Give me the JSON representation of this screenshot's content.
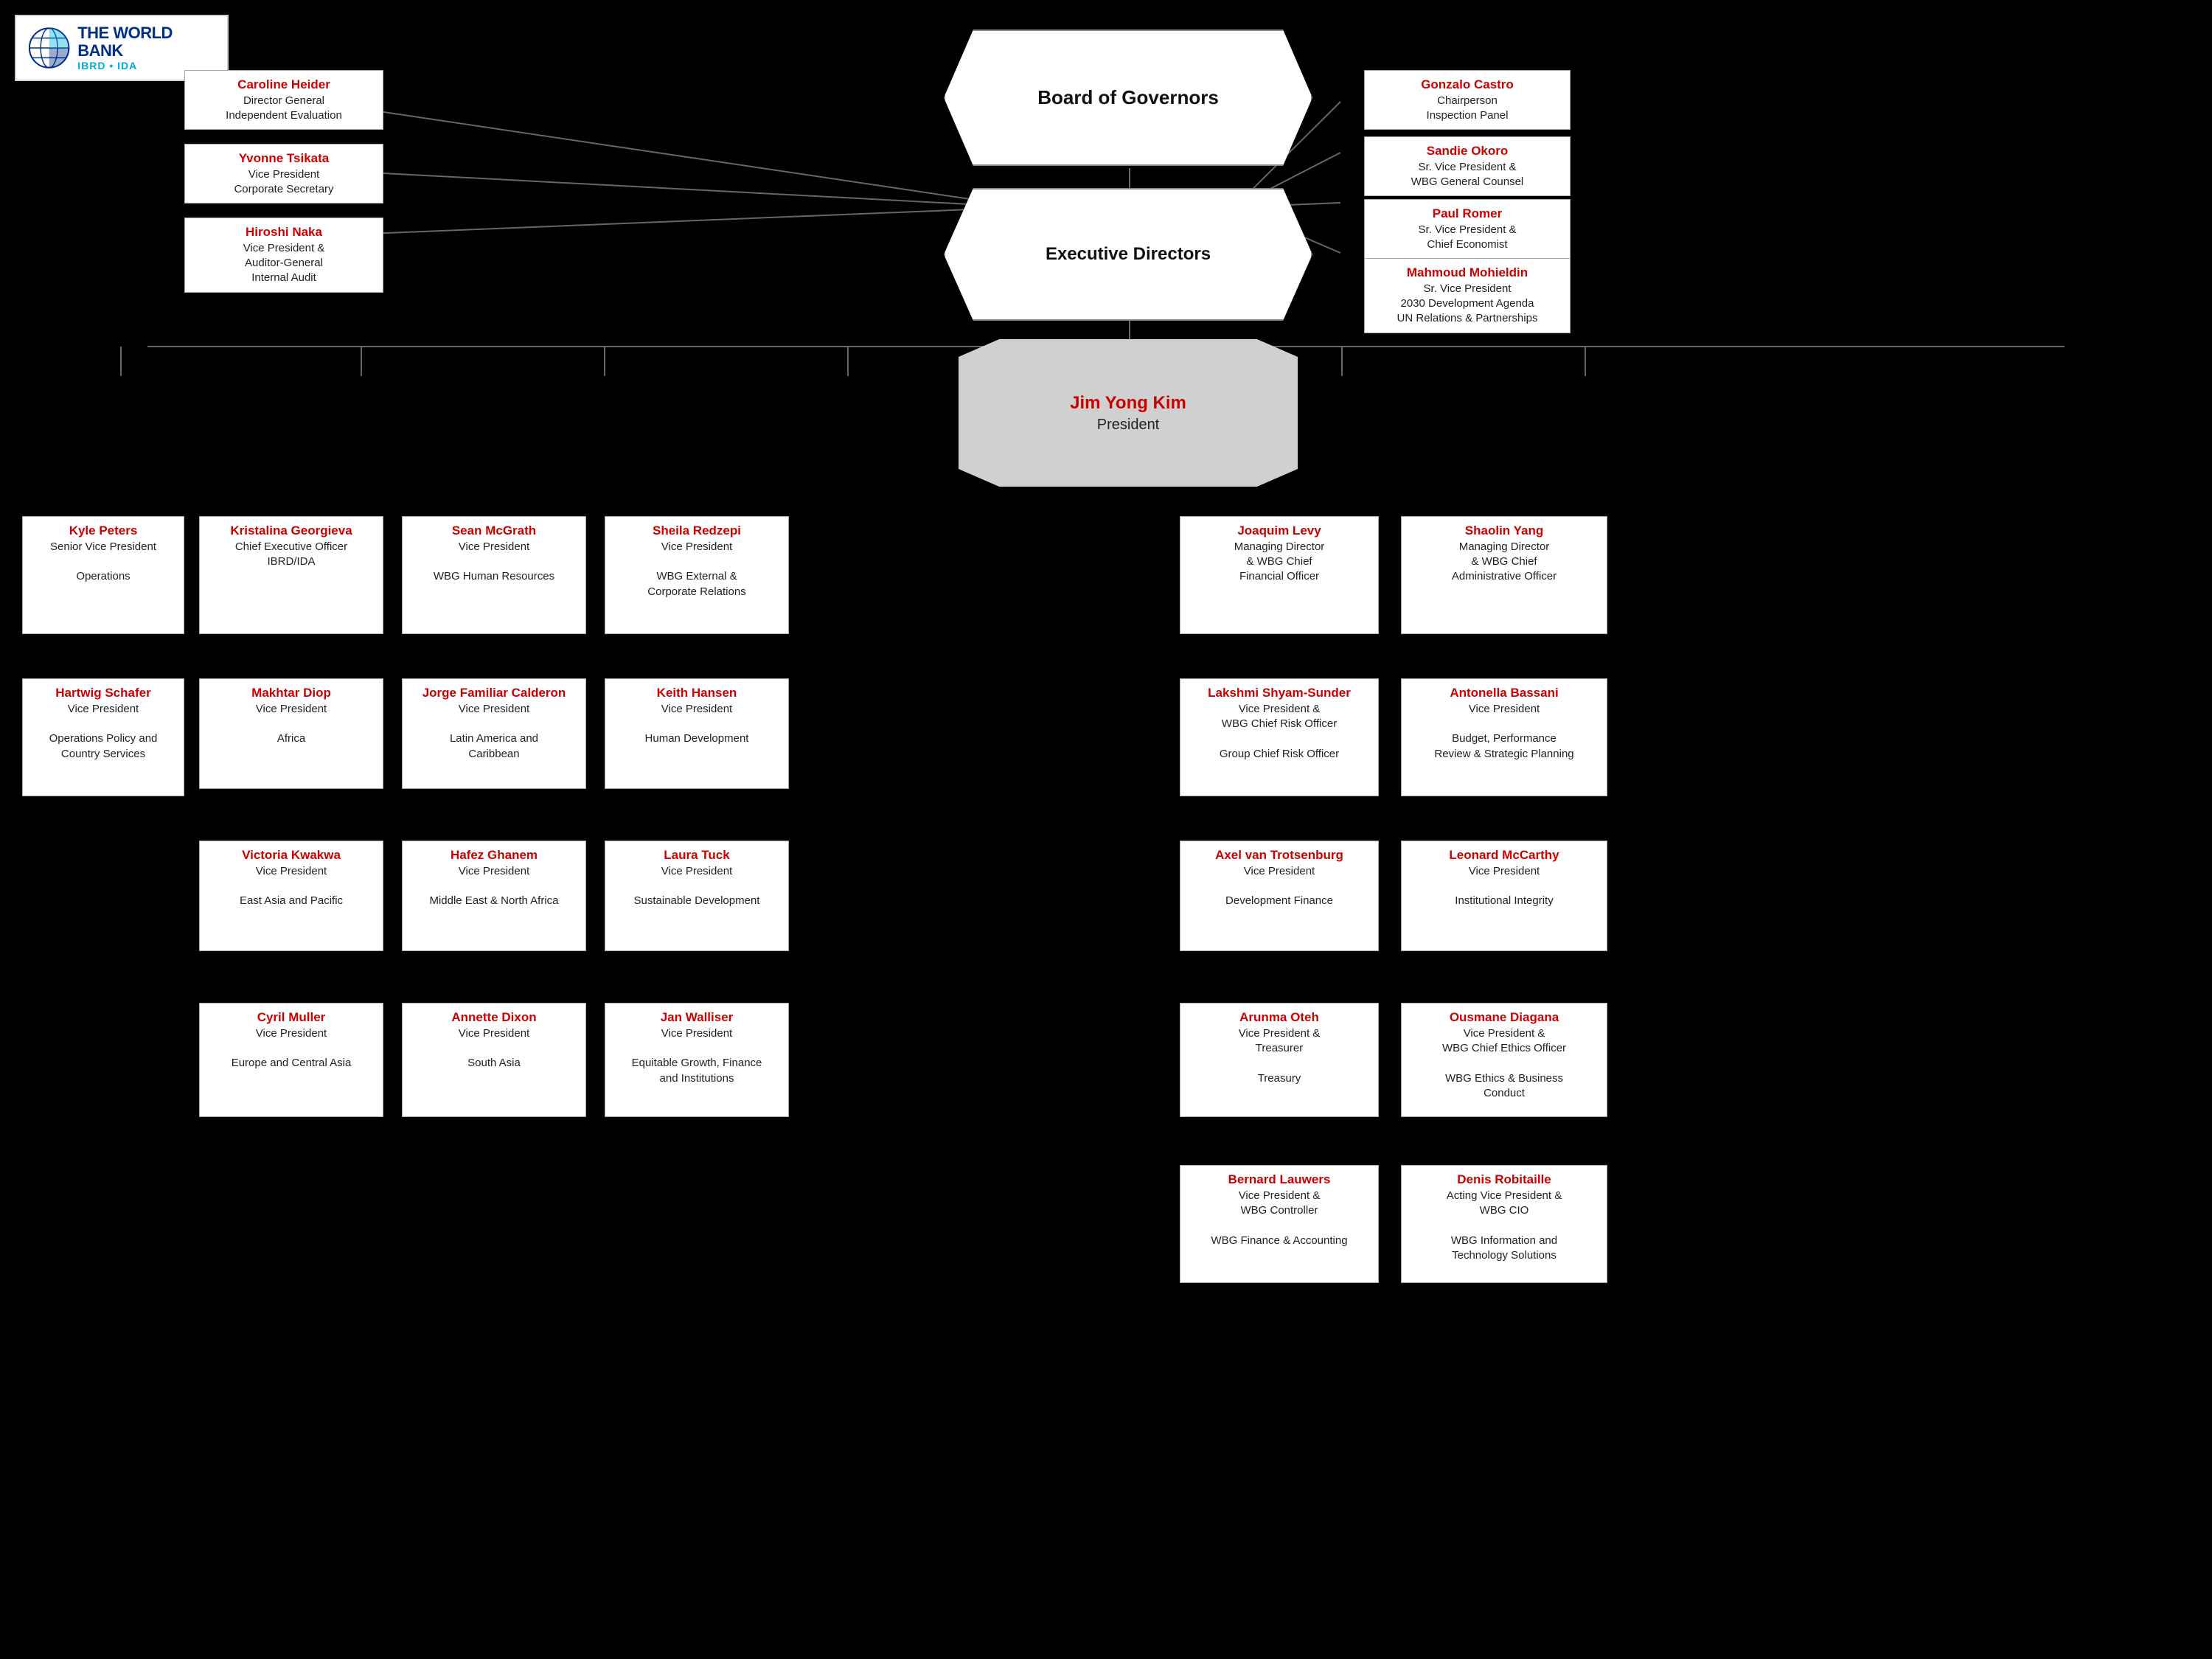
{
  "logo": {
    "main": "THE WORLD BANK",
    "sub": "IBRD • IDA"
  },
  "top_nodes": {
    "board_of_governors": {
      "label": "Board of Governors"
    },
    "executive_directors": {
      "label": "Executive Directors"
    },
    "president": {
      "name": "Jim Yong Kim",
      "title": "President"
    }
  },
  "left_direct_reports": [
    {
      "name": "Caroline Heider",
      "title": "Director General\nIndependent Evaluation"
    },
    {
      "name": "Yvonne Tsikata",
      "title": "Vice President\nCorporate Secretary"
    },
    {
      "name": "Hiroshi Naka",
      "title": "Vice President &\nAuditor-General\nInternal Audit"
    }
  ],
  "right_direct_reports": [
    {
      "name": "Gonzalo Castro",
      "title": "Chairperson\nInspection Panel"
    },
    {
      "name": "Sandie Okoro",
      "title": "Sr. Vice President &\nWBG General Counsel"
    },
    {
      "name": "Paul Romer",
      "title": "Sr. Vice President &\nChief Economist"
    },
    {
      "name": "Mahmoud Mohieldin",
      "title": "Sr. Vice President\n2030 Development Agenda\nUN Relations & Partnerships"
    }
  ],
  "row2": [
    {
      "name": "Kyle Peters",
      "title": "Senior Vice President\n\nOperations",
      "col": 0
    },
    {
      "name": "Kristalina Georgieva",
      "title": "Chief Executive Officer\nIBRD/IDA",
      "col": 1
    },
    {
      "name": "Sean McGrath",
      "title": "Vice President\n\nWBG Human Resources",
      "col": 2
    },
    {
      "name": "Sheila Redzepi",
      "title": "Vice President\n\nWBG External &\nCorporate Relations",
      "col": 3
    },
    {
      "name": "Joaquim Levy",
      "title": "Managing Director\n& WBG Chief\nFinancial Officer",
      "col": 4
    },
    {
      "name": "Shaolin Yang",
      "title": "Managing Director\n& WBG Chief\nAdministrative Officer",
      "col": 5
    }
  ],
  "row3_left": [
    {
      "name": "Hartwig Schafer",
      "title": "Vice President\n\nOperations Policy and\nCountry Services"
    }
  ],
  "row3": [
    {
      "name": "Makhtar Diop",
      "title": "Vice President\n\nAfrica"
    },
    {
      "name": "Jorge Familiar Calderon",
      "title": "Vice President\n\nLatin America and\nCaribbean"
    },
    {
      "name": "Keith Hansen",
      "title": "Vice President\n\nHuman Development"
    }
  ],
  "row3_right": [
    {
      "name": "Lakshmi Shyam-Sunder",
      "title": "Vice President &\nWBG Chief Risk Officer\n\nGroup Chief Risk Officer"
    },
    {
      "name": "Antonella Bassani",
      "title": "Vice President\n\nBudget, Performance\nReview & Strategic Planning"
    }
  ],
  "row4": [
    {
      "name": "Victoria Kwakwa",
      "title": "Vice President\n\nEast Asia and Pacific"
    },
    {
      "name": "Hafez Ghanem",
      "title": "Vice President\n\nMiddle East & North Africa"
    },
    {
      "name": "Laura Tuck",
      "title": "Vice President\n\nSustainable Development"
    }
  ],
  "row4_right": [
    {
      "name": "Axel van Trotsenburg",
      "title": "Vice President\n\nDevelopment Finance"
    },
    {
      "name": "Leonard McCarthy",
      "title": "Vice President\n\nInstitutional Integrity"
    }
  ],
  "row5": [
    {
      "name": "Cyril Muller",
      "title": "Vice President\n\nEurope and Central Asia"
    },
    {
      "name": "Annette Dixon",
      "title": "Vice President\n\nSouth Asia"
    },
    {
      "name": "Jan Walliser",
      "title": "Vice President\n\nEquitable Growth, Finance\nand Institutions"
    }
  ],
  "row5_right": [
    {
      "name": "Arunma Oteh",
      "title": "Vice President &\nTreasurer\n\nTreasury"
    },
    {
      "name": "Ousmane Diagana",
      "title": "Vice President  &\nWBG Chief Ethics Officer\n\nWBG Ethics & Business\nConduct"
    }
  ],
  "row6_right": [
    {
      "name": "Bernard Lauwers",
      "title": "Vice President &\nWBG Controller\n\nWBG Finance & Accounting"
    },
    {
      "name": "Denis Robitaille",
      "title": "Acting Vice President &\nWBG CIO\n\nWBG Information and\nTechnology Solutions"
    }
  ]
}
